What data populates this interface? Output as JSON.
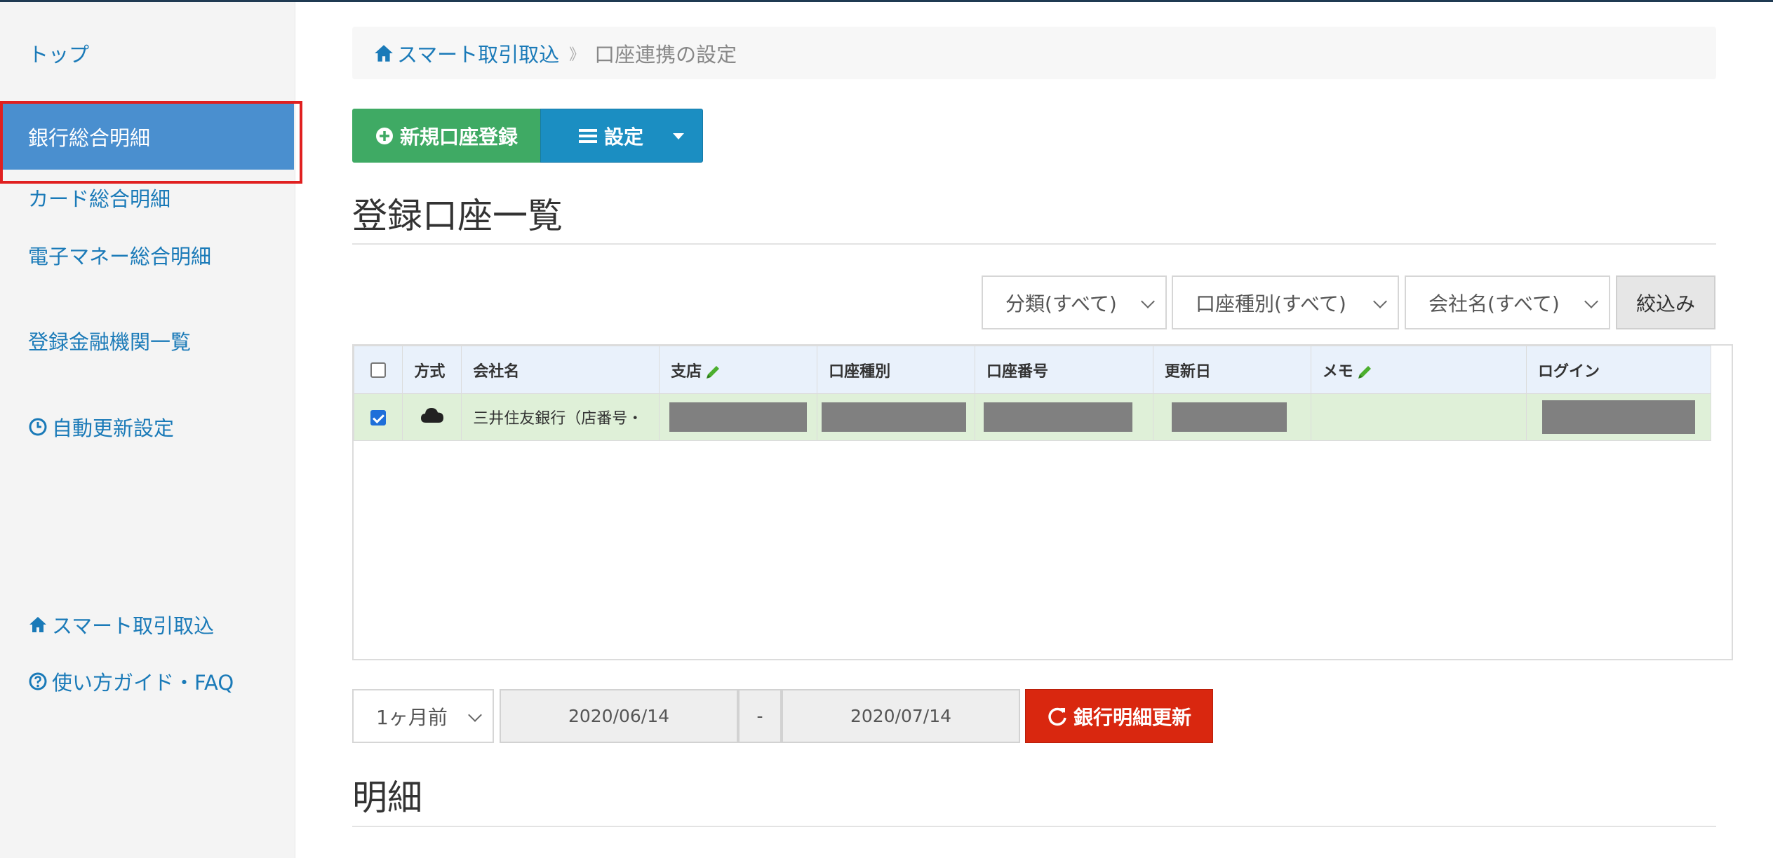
{
  "sidebar": {
    "top": "トップ",
    "bank_summary": "銀行総合明細",
    "card_summary": "カード総合明細",
    "emoney_summary": "電子マネー総合明細",
    "financial_list": "登録金融機関一覧",
    "auto_update": "自動更新設定",
    "smart_import": "スマート取引取込",
    "guide": "使い方ガイド・FAQ"
  },
  "breadcrumb": {
    "home": "スマート取引取込",
    "separator": "》",
    "current": "口座連携の設定"
  },
  "toolbar": {
    "new_account": "新規口座登録",
    "settings": "設定"
  },
  "accounts_heading": "登録口座一覧",
  "filters": {
    "category": "分類(すべて)",
    "account_type": "口座種別(すべて)",
    "company": "会社名(すべて)",
    "filter_button": "絞込み"
  },
  "table": {
    "headers": [
      "方式",
      "会社名",
      "支店",
      "口座種別",
      "口座番号",
      "更新日",
      "メモ",
      "ログイン"
    ],
    "rows": [
      {
        "checked": true,
        "method_icon": "cloud-icon",
        "company": "三井住友銀行（店番号・"
      }
    ]
  },
  "period": {
    "selected": "1ヶ月前",
    "from": "2020/06/14",
    "dash": "-",
    "to": "2020/07/14",
    "update_button": "銀行明細更新"
  },
  "detail_heading": "明細",
  "colors": {
    "link": "#1a7ab8",
    "active": "#4a8fcf",
    "green": "#3faa64",
    "blue": "#1b8ec2",
    "red": "#d9270f",
    "row_selected": "#dff0d8"
  }
}
